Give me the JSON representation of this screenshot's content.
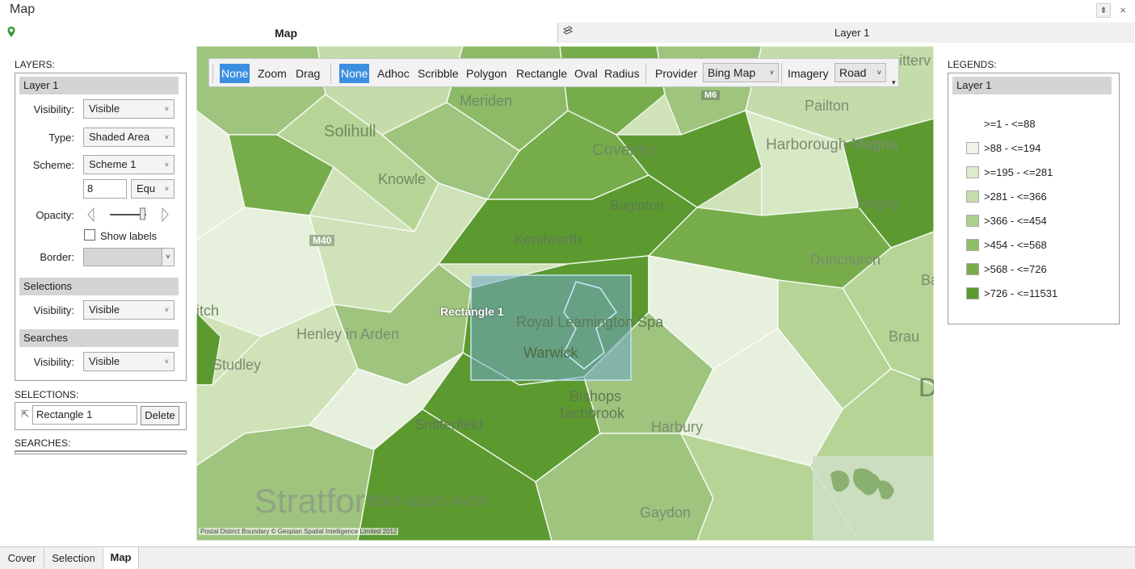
{
  "window": {
    "title": "Map",
    "pin_glyph": "⇟",
    "close_glyph": "×"
  },
  "header": {
    "map_tab": "Map",
    "layer_tab": "Layer 1"
  },
  "left": {
    "layers_title": "LAYERS:",
    "layer_group": "Layer 1",
    "visibility_label": "Visibility:",
    "visibility_value": "Visible",
    "type_label": "Type:",
    "type_value": "Shaded Area",
    "scheme_label": "Scheme:",
    "scheme_value": "Scheme 1",
    "classes_value": "8",
    "method_value": "Equ",
    "opacity_label": "Opacity:",
    "opacity_level": 0.9,
    "show_labels": "Show labels",
    "border_label": "Border:",
    "selections_group": "Selections",
    "sel_visibility_label": "Visibility:",
    "sel_visibility_value": "Visible",
    "searches_group": "Searches",
    "search_visibility_label": "Visibility:",
    "search_visibility_value": "Visible",
    "selections_title": "SELECTIONS:",
    "selection_name": "Rectangle 1",
    "delete_label": "Delete",
    "searches_title": "SEARCHES:"
  },
  "toolbar": {
    "nav": [
      "None",
      "Zoom",
      "Drag"
    ],
    "tools": [
      "None",
      "Adhoc",
      "Scribble",
      "Polygon",
      "Rectangle",
      "Oval",
      "Radius"
    ],
    "provider_label": "Provider",
    "provider_value": "Bing Map",
    "imagery_label": "Imagery",
    "imagery_value": "Road"
  },
  "map": {
    "places": [
      "Meriden",
      "Pailton",
      "Solihull",
      "Coventry",
      "Harborough Magna",
      "Knowle",
      "Baginton",
      "Rugby",
      "Kenilworth",
      "M40",
      "M6",
      "Dunchurch",
      "Bar",
      "itch",
      "Henley in Arden",
      "Royal Leamington Spa",
      "Warwick",
      "Brau",
      "Studley",
      "Bishops",
      "Tachbrook",
      "Snitterfield",
      "Harbury",
      "Stratfor",
      "tford-upon-Avon",
      "Gaydon",
      "D",
      "itterv"
    ],
    "selection_label": "Rectangle 1",
    "copyright": "Postal District Boundary © Geoplan Spatial Intelligence Limited 2012"
  },
  "legend": {
    "title": "LEGENDS:",
    "layer": "Layer 1",
    "items": [
      {
        "label": ">=1 - <=88",
        "color": "#ffffff"
      },
      {
        "label": ">88 - <=194",
        "color": "#eef4e6"
      },
      {
        "label": ">=195 - <=281",
        "color": "#dcebcd"
      },
      {
        "label": ">281 - <=366",
        "color": "#c6deae"
      },
      {
        "label": ">366 - <=454",
        "color": "#add08c"
      },
      {
        "label": ">454 - <=568",
        "color": "#91bf69"
      },
      {
        "label": ">568 - <=726",
        "color": "#76ad4a"
      },
      {
        "label": ">726 - <=11531",
        "color": "#5c9a30"
      }
    ]
  },
  "bottom_tabs": [
    "Cover",
    "Selection",
    "Map"
  ]
}
